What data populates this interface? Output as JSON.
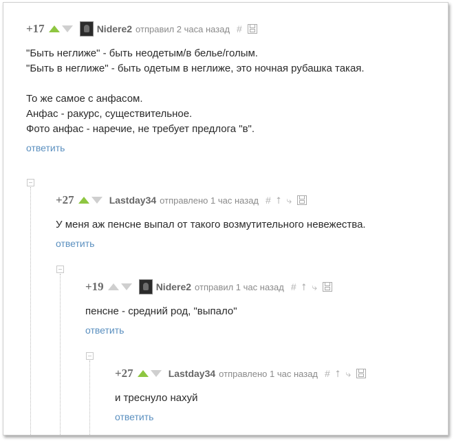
{
  "icons": {
    "hash": "#",
    "up": "⭡",
    "branch": "⤷"
  },
  "comments": [
    {
      "rating": "+17",
      "author": "Nidere2",
      "meta": "отправил 2 часа назад",
      "lines": [
        "\"Быть неглиже\" - быть неодетым/в белье/голым.",
        "\"Быть в неглиже\" - быть одетым в неглиже, это ночная рубашка такая.",
        "",
        "То же самое с анфасом.",
        "Анфас - ракурс, существительное.",
        "Фото анфас - наречие, не требует предлога \"в\"."
      ],
      "reply": "ответить"
    },
    {
      "rating": "+27",
      "author": "Lastday34",
      "meta": "отправлено 1 час назад",
      "lines": [
        "У меня аж пенсне выпал от такого возмутительного невежества."
      ],
      "reply": "ответить"
    },
    {
      "rating": "+19",
      "author": "Nidere2",
      "meta": "отправил 1 час назад",
      "lines": [
        "пенсне - средний род, \"выпало\""
      ],
      "reply": "ответить"
    },
    {
      "rating": "+27",
      "author": "Lastday34",
      "meta": "отправлено 1 час назад",
      "lines": [
        "и треснуло нахуй"
      ],
      "reply": "ответить"
    }
  ]
}
